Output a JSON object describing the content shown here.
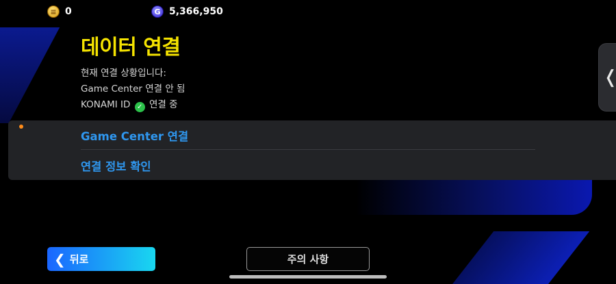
{
  "currency": {
    "coins": "0",
    "gp": "5,366,950",
    "coin_icon_glyph": "≡",
    "gp_icon_glyph": "G"
  },
  "page": {
    "title": "데이터 연결",
    "status_heading": "현재 연결 상황입니다:",
    "game_center_status": "Game Center 연결 안 됨",
    "konami_label": "KONAMI ID",
    "konami_status": "연결 중",
    "check_glyph": "✓"
  },
  "menu": {
    "items": [
      {
        "label": "Game Center 연결"
      },
      {
        "label": "연결 정보 확인"
      }
    ]
  },
  "side_handle": {
    "glyph": "❬"
  },
  "footer": {
    "back_glyph": "❮",
    "back_label": "뒤로",
    "notice_label": "주의 사항"
  },
  "colors": {
    "title": "#f5e300",
    "menu_link": "#2f97ef",
    "back_gradient_start": "#1a66ff",
    "back_gradient_end": "#19d7f0",
    "panel": "#222326",
    "notification_dot": "#ff8c1a",
    "check": "#2cc14a"
  }
}
